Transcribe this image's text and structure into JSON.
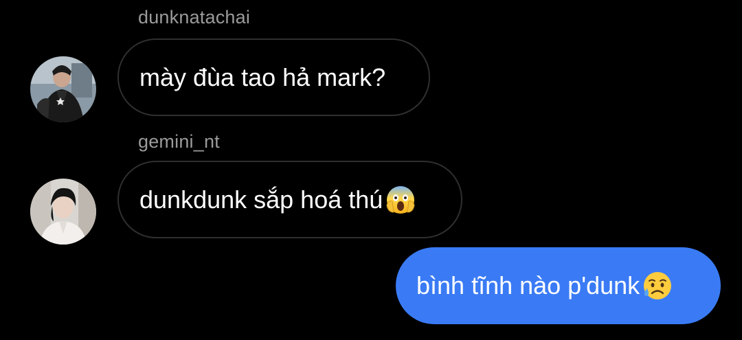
{
  "messages": [
    {
      "sender": "dunknatachai",
      "text": "mày đùa tao hả mark?",
      "avatar_icon": "profile-photo-dunknatachai"
    },
    {
      "sender": "gemini_nt",
      "text": "dunkdunk sắp hoá thú",
      "avatar_icon": "profile-photo-gemini_nt",
      "emoji_icon": "face-screaming-in-fear-emoji"
    }
  ],
  "outgoing": {
    "text": "bình tĩnh nào p'dunk ",
    "emoji_icon": "sad-but-relieved-face-emoji",
    "bubble_color": "#3a7bf5"
  },
  "colors": {
    "background": "#000000",
    "incoming_border": "#2f2f2f",
    "sender_name": "#9b9b9b"
  }
}
